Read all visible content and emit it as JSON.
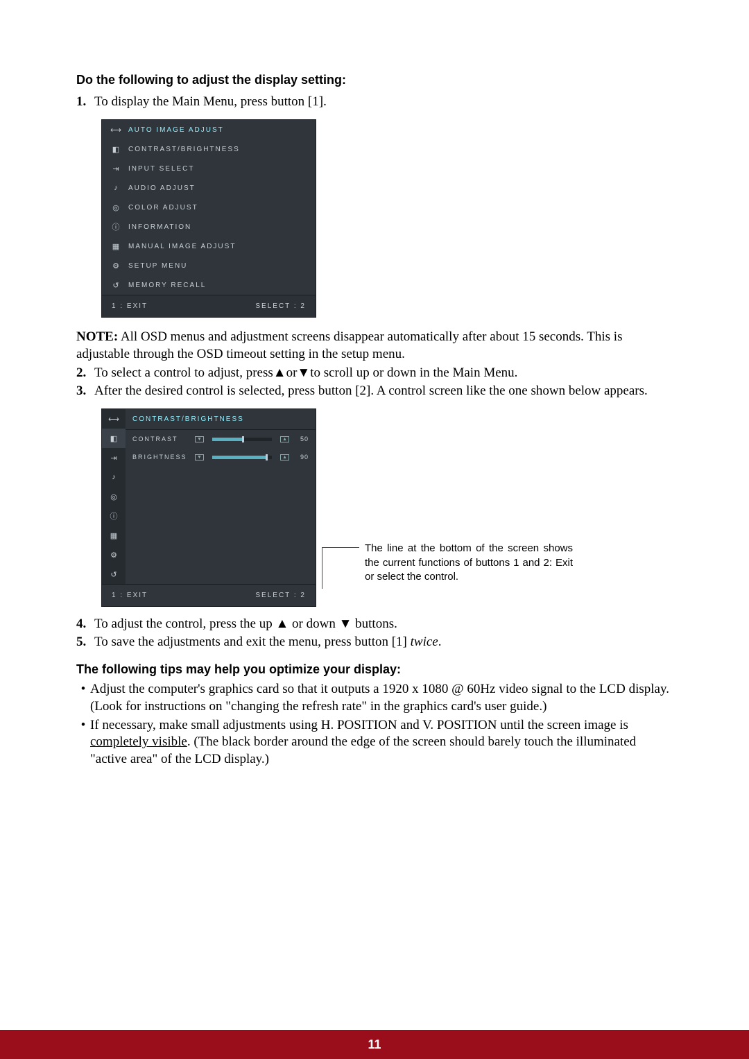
{
  "heading1": "Do the following to adjust the display setting:",
  "steps": {
    "s1_num": "1.",
    "s1": "To display the Main Menu, press button [1].",
    "s2_num": "2.",
    "s2_a": "To select a control to adjust, press",
    "s2_b": "or",
    "s2_c": "to scroll up or down in the Main Menu.",
    "s3_num": "3.",
    "s3": "After the desired control is selected, press button [2]. A control screen like the one shown below appears.",
    "s4_num": "4.",
    "s4_a": "To adjust the control, press the up ",
    "s4_b": " or down ",
    "s4_c": " buttons.",
    "s5_num": "5.",
    "s5_a": "To save the adjustments and exit the menu, press button [1] ",
    "s5_em": "twice",
    "s5_b": "."
  },
  "note": {
    "label": "NOTE:",
    "text": " All OSD menus and adjustment screens disappear automatically after about 15 seconds. This is adjustable through the OSD timeout setting in the setup menu."
  },
  "osd1": {
    "items": [
      "AUTO IMAGE ADJUST",
      "CONTRAST/BRIGHTNESS",
      "INPUT SELECT",
      "AUDIO ADJUST",
      "COLOR ADJUST",
      "INFORMATION",
      "MANUAL IMAGE ADJUST",
      "SETUP MENU",
      "MEMORY RECALL"
    ],
    "footer_left": "1 : EXIT",
    "footer_right": "SELECT : 2",
    "icons": [
      "⟷",
      "◧",
      "⇥",
      "♪",
      "◎",
      "ⓘ",
      "▦",
      "⚙",
      "↺"
    ]
  },
  "osd2": {
    "title": "CONTRAST/BRIGHTNESS",
    "rows": [
      {
        "label": "CONTRAST",
        "value": "50",
        "fill_pct": 50,
        "thumb_pct": 50
      },
      {
        "label": "BRIGHTNESS",
        "value": "90",
        "fill_pct": 90,
        "thumb_pct": 90
      }
    ],
    "side_icons": [
      "⟷",
      "◧",
      "⇥",
      "♪",
      "◎",
      "ⓘ",
      "▦",
      "⚙",
      "↺"
    ],
    "footer_left": "1 : EXIT",
    "footer_right": "SELECT : 2"
  },
  "callout": "The line at the bottom of the screen shows the current functions of buttons 1 and 2: Exit or select the control.",
  "tips_heading": "The following tips may help you optimize your display:",
  "tips": {
    "b1": "Adjust the computer's graphics card so that it outputs a 1920 x 1080 @ 60Hz video signal to the LCD display. (Look for instructions on \"changing the refresh rate\" in the graphics card's user guide.)",
    "b2_a": "If necessary, make small adjustments using H. POSITION and V. POSITION until the screen image is ",
    "b2_u": "completely visible",
    "b2_b": ". (The black border around the edge of the screen should barely touch the illuminated \"active area\" of the LCD display.)"
  },
  "page_number": "11",
  "glyphs": {
    "up": "▲",
    "down": "▼",
    "bullet": "•"
  }
}
